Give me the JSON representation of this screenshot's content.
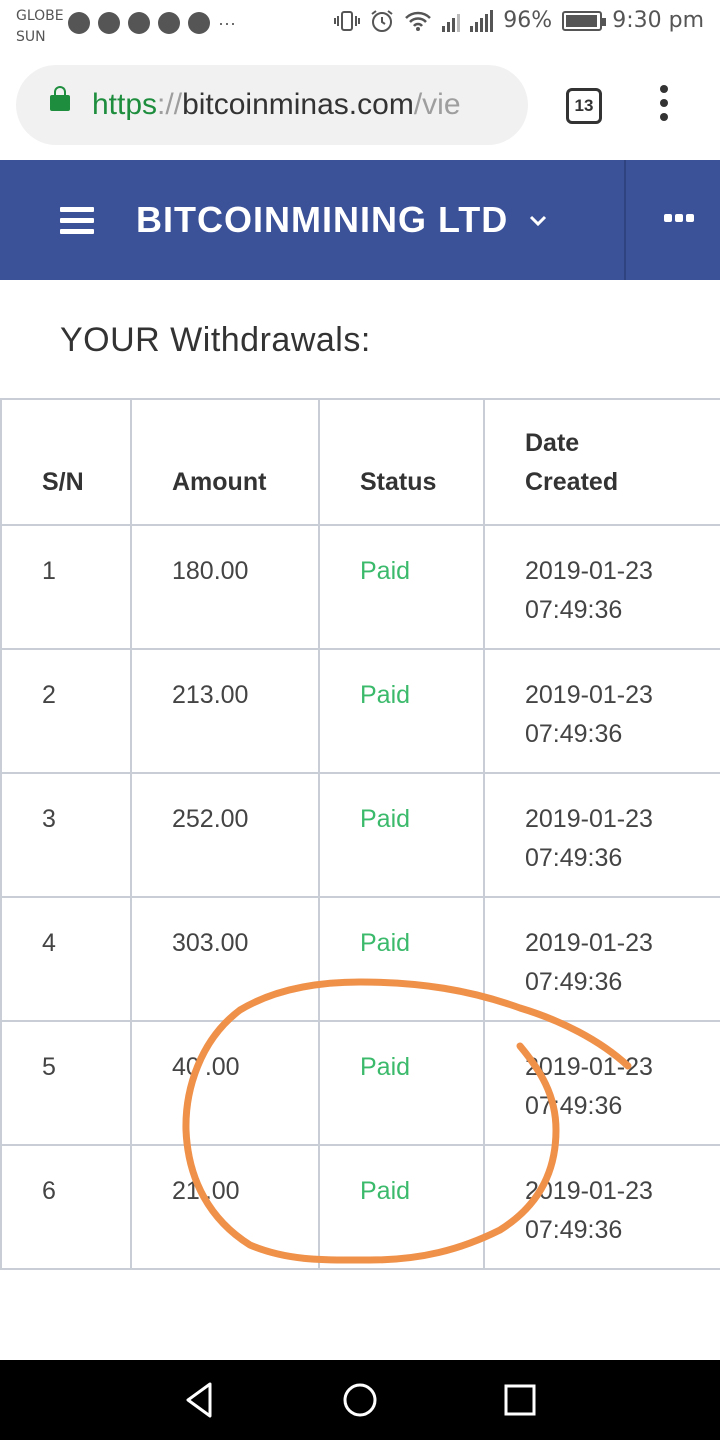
{
  "status_bar": {
    "carrier_line1": "GLOBE",
    "carrier_line2": "SUN",
    "notification_icons": [
      "messenger-icon",
      "chrome-icon",
      "telegram-icon",
      "whatsapp-icon",
      "snapchat-icon"
    ],
    "more_notifications": "···",
    "battery_percent": "96%",
    "battery_level": 0.96,
    "time": "9:30 pm"
  },
  "browser": {
    "url_scheme": "https",
    "url_separator": "://",
    "url_host": "bitcoinminas.com",
    "url_path": "/vie",
    "tab_count": "13"
  },
  "site_header": {
    "brand": "BITCOINMINING LTD",
    "background_color": "#3b5198"
  },
  "page": {
    "title": "YOUR Withdrawals:"
  },
  "table": {
    "headers": {
      "sn": "S/N",
      "amount": "Amount",
      "status": "Status",
      "date_line1": "Date",
      "date_line2": "Created"
    },
    "rows": [
      {
        "sn": "1",
        "amount": "180.00",
        "status": "Paid",
        "date": "2019-01-23",
        "time": "07:49:36"
      },
      {
        "sn": "2",
        "amount": "213.00",
        "status": "Paid",
        "date": "2019-01-23",
        "time": "07:49:36"
      },
      {
        "sn": "3",
        "amount": "252.00",
        "status": "Paid",
        "date": "2019-01-23",
        "time": "07:49:36"
      },
      {
        "sn": "4",
        "amount": "303.00",
        "status": "Paid",
        "date": "2019-01-23",
        "time": "07:49:36"
      },
      {
        "sn": "5",
        "amount": "40 .00",
        "status": "Paid",
        "date": "2019-01-23",
        "time": "07:49:36"
      },
      {
        "sn": "6",
        "amount": "21 .00",
        "status": "Paid",
        "date": "2019-01-23",
        "time": "07:49:36"
      }
    ],
    "status_color": "#3cba6c"
  },
  "annotation": {
    "color": "#f0914a"
  }
}
